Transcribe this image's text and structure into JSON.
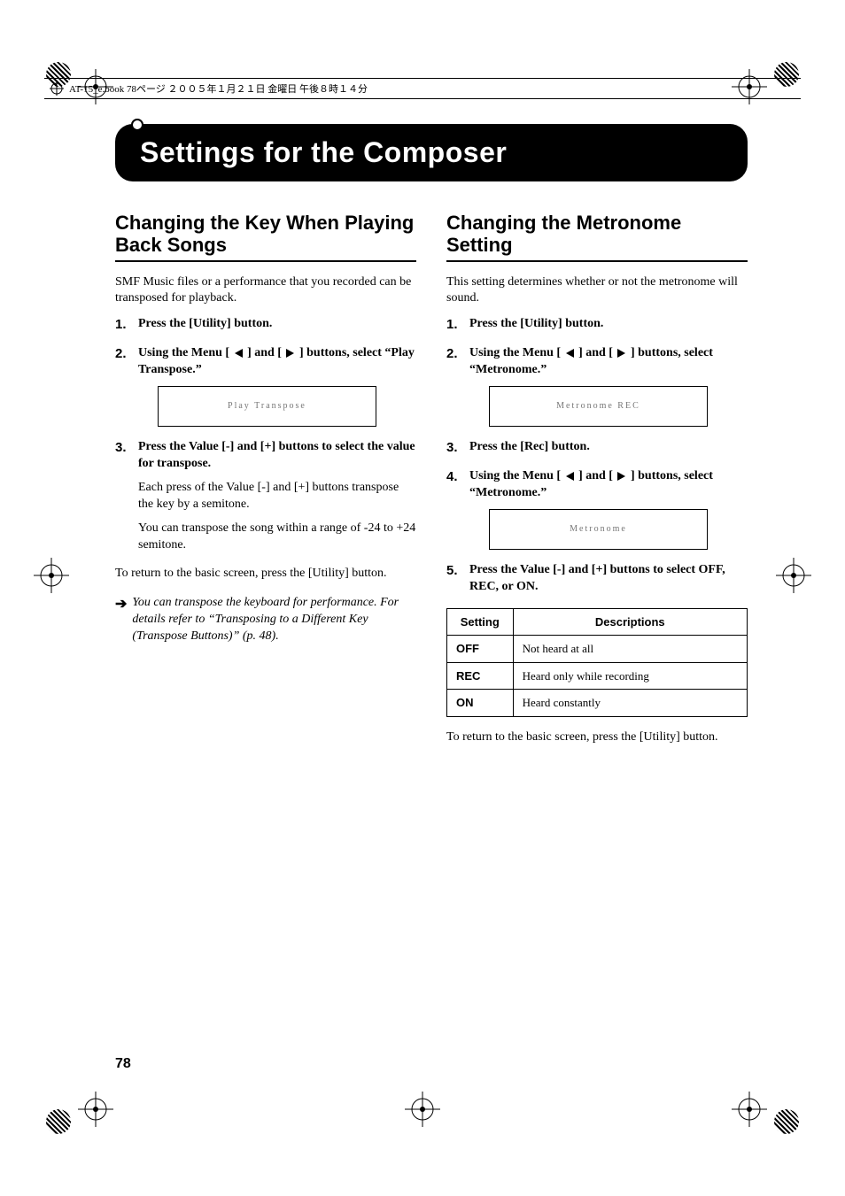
{
  "header_line": "AT-15_e.book 78ページ ２００５年１月２１日 金曜日 午後８時１４分",
  "title": "Settings for the Composer",
  "left": {
    "heading": "Changing the Key When Playing Back Songs",
    "intro": "SMF Music files or a performance that you recorded can be transposed for playback.",
    "steps": [
      {
        "text": "Press the [Utility] button."
      },
      {
        "text_pre": "Using the Menu [ ",
        "text_mid": " ] and [ ",
        "text_post": " ] buttons, select “Play Transpose.”",
        "lcd": "Play Transpose"
      },
      {
        "text": "Press the Value [-] and [+] buttons to select the value for transpose.",
        "subs": [
          "Each press of the Value [-] and [+] buttons transpose the key by a semitone.",
          "You can transpose the song within a range of -24 to +24 semitone."
        ]
      }
    ],
    "return_line": "To return to the basic screen, press the [Utility] button.",
    "note": "You can transpose the keyboard for performance. For details refer to “Transposing to a Different Key (Transpose Buttons)” (p. 48)."
  },
  "right": {
    "heading": "Changing the Metronome Setting",
    "intro": "This setting determines whether or not the metronome will sound.",
    "steps": [
      {
        "text": "Press the [Utility] button."
      },
      {
        "text_pre": "Using the Menu [ ",
        "text_mid": " ] and [ ",
        "text_post": " ] buttons, select “Metronome.”",
        "lcd": "Metronome  REC"
      },
      {
        "text": "Press the [Rec] button."
      },
      {
        "text_pre": "Using the Menu [ ",
        "text_mid": " ] and [ ",
        "text_post": " ] buttons, select “Metronome.”",
        "lcd": "Metronome"
      },
      {
        "text": "Press the Value [-] and [+] buttons to select OFF, REC, or ON."
      }
    ],
    "table": {
      "headers": [
        "Setting",
        "Descriptions"
      ],
      "rows": [
        [
          "OFF",
          "Not heard at all"
        ],
        [
          "REC",
          "Heard only while recording"
        ],
        [
          "ON",
          "Heard constantly"
        ]
      ]
    },
    "return_line": "To return to the basic screen, press the [Utility] button."
  },
  "page_number": "78"
}
